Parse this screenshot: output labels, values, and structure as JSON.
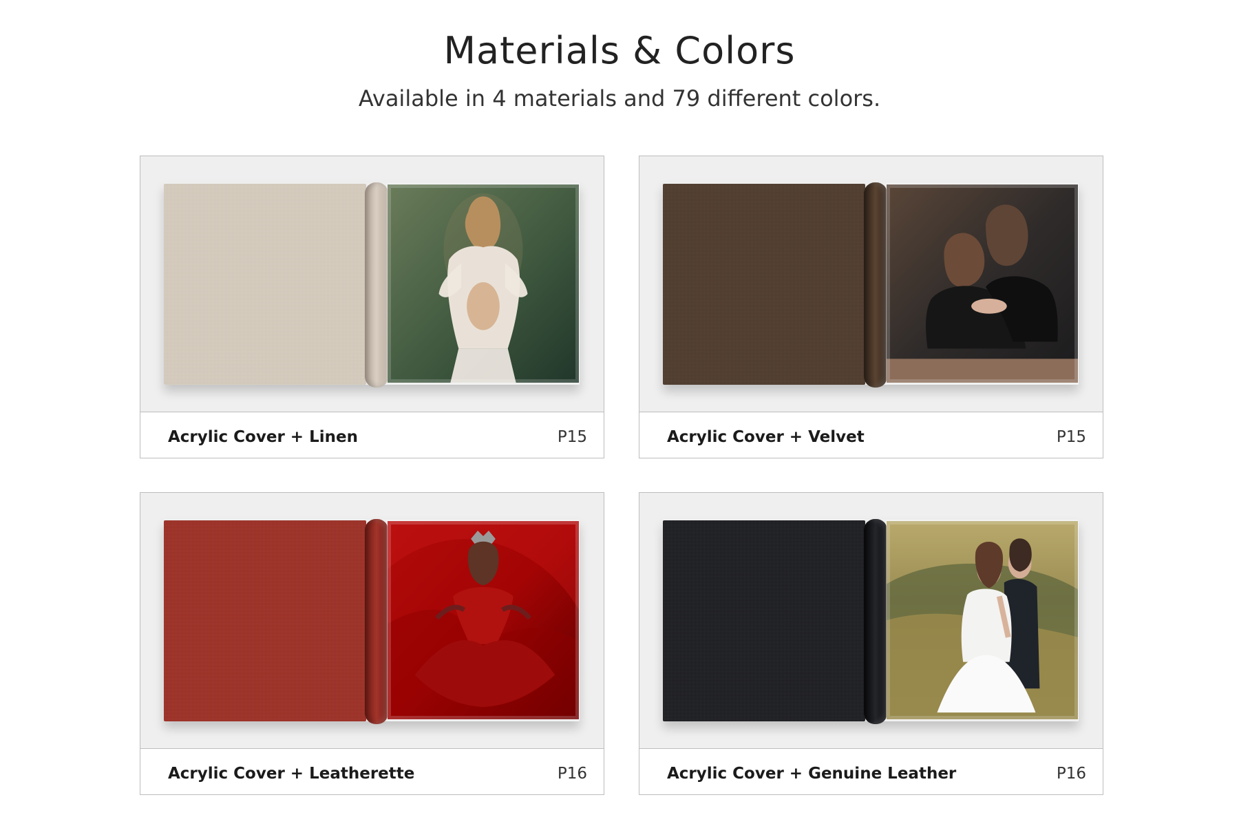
{
  "header": {
    "title": "Materials & Colors",
    "subtitle": "Available in 4 materials and 79 different colors."
  },
  "cards": [
    {
      "name": "Acrylic Cover + Linen",
      "page": "P15",
      "cover_color": "#d8cdbf",
      "spine_color": "#c9bcaf",
      "photo_theme": "maternity"
    },
    {
      "name": "Acrylic Cover + Velvet",
      "page": "P15",
      "cover_color": "#4b3728",
      "spine_color": "#3e2d21",
      "photo_theme": "two-girls"
    },
    {
      "name": "Acrylic Cover + Leatherette",
      "page": "P16",
      "cover_color": "#9d2b21",
      "spine_color": "#8b231b",
      "photo_theme": "red-gown"
    },
    {
      "name": "Acrylic Cover + Genuine Leather",
      "page": "P16",
      "cover_color": "#17181c",
      "spine_color": "#101114",
      "photo_theme": "wedding-couple"
    }
  ]
}
